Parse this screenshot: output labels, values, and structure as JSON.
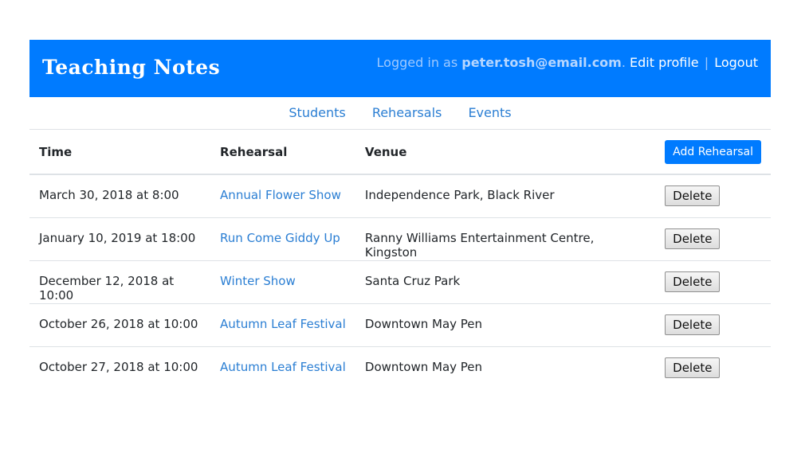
{
  "header": {
    "brand": "Teaching Notes",
    "logged_in_prefix": "Logged in as",
    "email": "peter.tosh@email.com",
    "email_suffix": ".",
    "edit_profile": "Edit profile",
    "separator": "|",
    "logout": "Logout"
  },
  "nav": {
    "students": "Students",
    "rehearsals": "Rehearsals",
    "events": "Events"
  },
  "table": {
    "columns": {
      "time": "Time",
      "rehearsal": "Rehearsal",
      "venue": "Venue"
    },
    "add_button": "Add Rehearsal",
    "delete_label": "Delete",
    "rows": [
      {
        "time": "March 30, 2018 at 8:00",
        "rehearsal": "Annual Flower Show",
        "venue": "Independence Park, Black River"
      },
      {
        "time": "January 10, 2019 at 18:00",
        "rehearsal": "Run Come Giddy Up",
        "venue": "Ranny Williams Entertainment Centre, Kingston"
      },
      {
        "time": "December 12, 2018 at 10:00",
        "rehearsal": "Winter Show",
        "venue": "Santa Cruz Park"
      },
      {
        "time": "October 26, 2018 at 10:00",
        "rehearsal": "Autumn Leaf Festival",
        "venue": "Downtown May Pen"
      },
      {
        "time": "October 27, 2018 at 10:00",
        "rehearsal": "Autumn Leaf Festival",
        "venue": "Downtown May Pen"
      }
    ]
  },
  "colors": {
    "primary": "#007bff",
    "link": "#2a7ed3"
  }
}
